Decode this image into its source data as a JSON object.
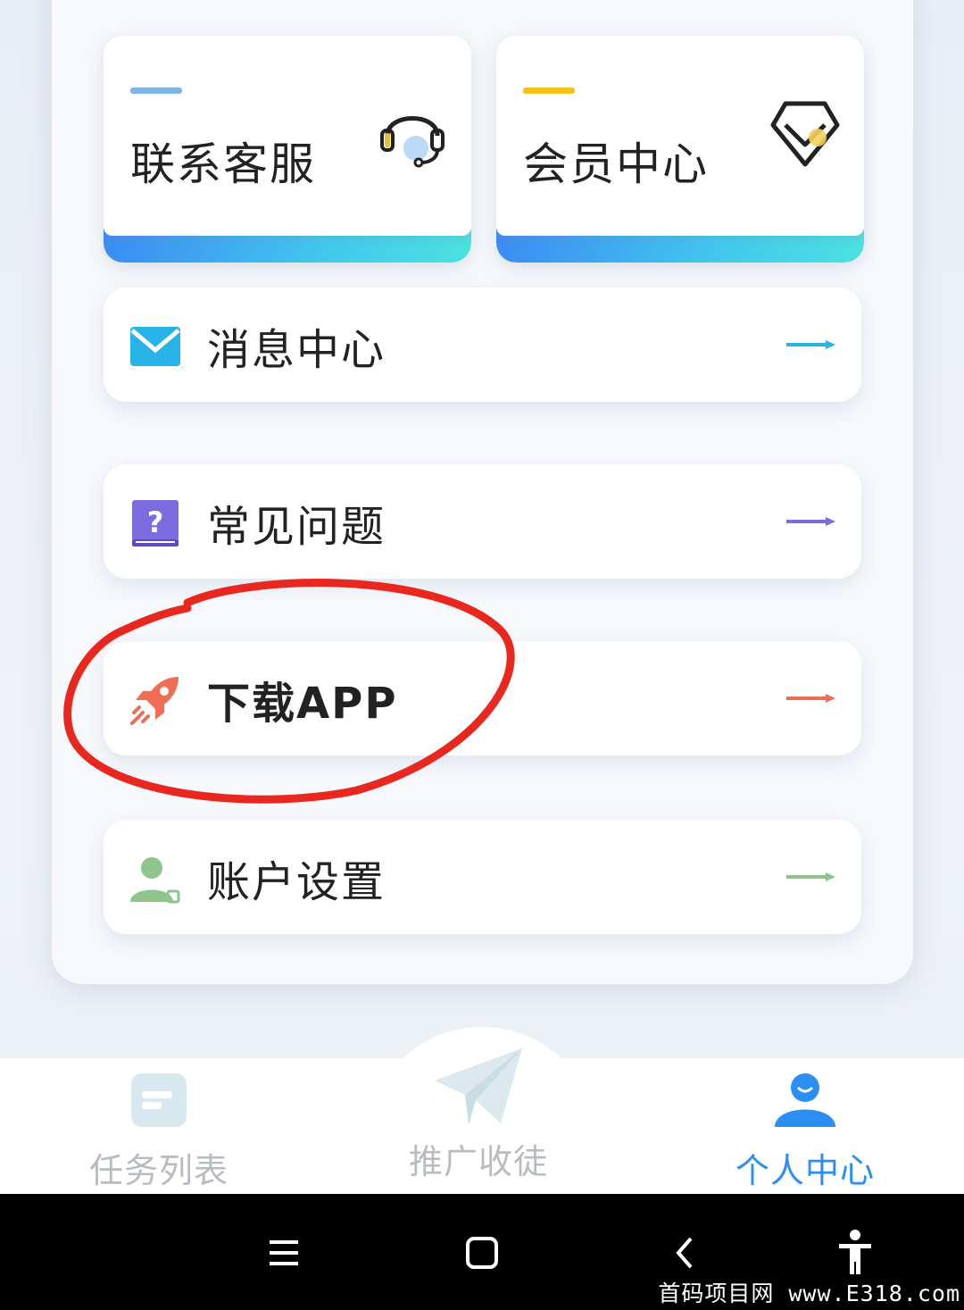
{
  "cards": [
    {
      "label": "联系客服",
      "icon": "headset-icon",
      "accent": "#7bb5ea"
    },
    {
      "label": "会员中心",
      "icon": "diamond-icon",
      "accent": "#f4c21a"
    }
  ],
  "menu": [
    {
      "label": "消息中心",
      "icon": "mail-icon",
      "arrow_color": "#27b3e8"
    },
    {
      "label": "常见问题",
      "icon": "question-book-icon",
      "arrow_color": "#7b6ce0"
    },
    {
      "label": "下载APP",
      "icon": "rocket-icon",
      "arrow_color": "#ef6d55"
    },
    {
      "label": "账户设置",
      "icon": "user-settings-icon",
      "arrow_color": "#8fc58a"
    }
  ],
  "tabs": [
    {
      "label": "任务列表",
      "icon": "task-list-icon",
      "active": false
    },
    {
      "label": "推广收徒",
      "icon": "paper-plane-icon",
      "active": false
    },
    {
      "label": "个人中心",
      "icon": "profile-icon",
      "active": true
    }
  ],
  "colors": {
    "active_tab": "#2b8ef2",
    "inactive_tab": "#b8bcc2",
    "annotation": "#e8281e"
  },
  "watermark": "首码项目网 www.E318.com"
}
